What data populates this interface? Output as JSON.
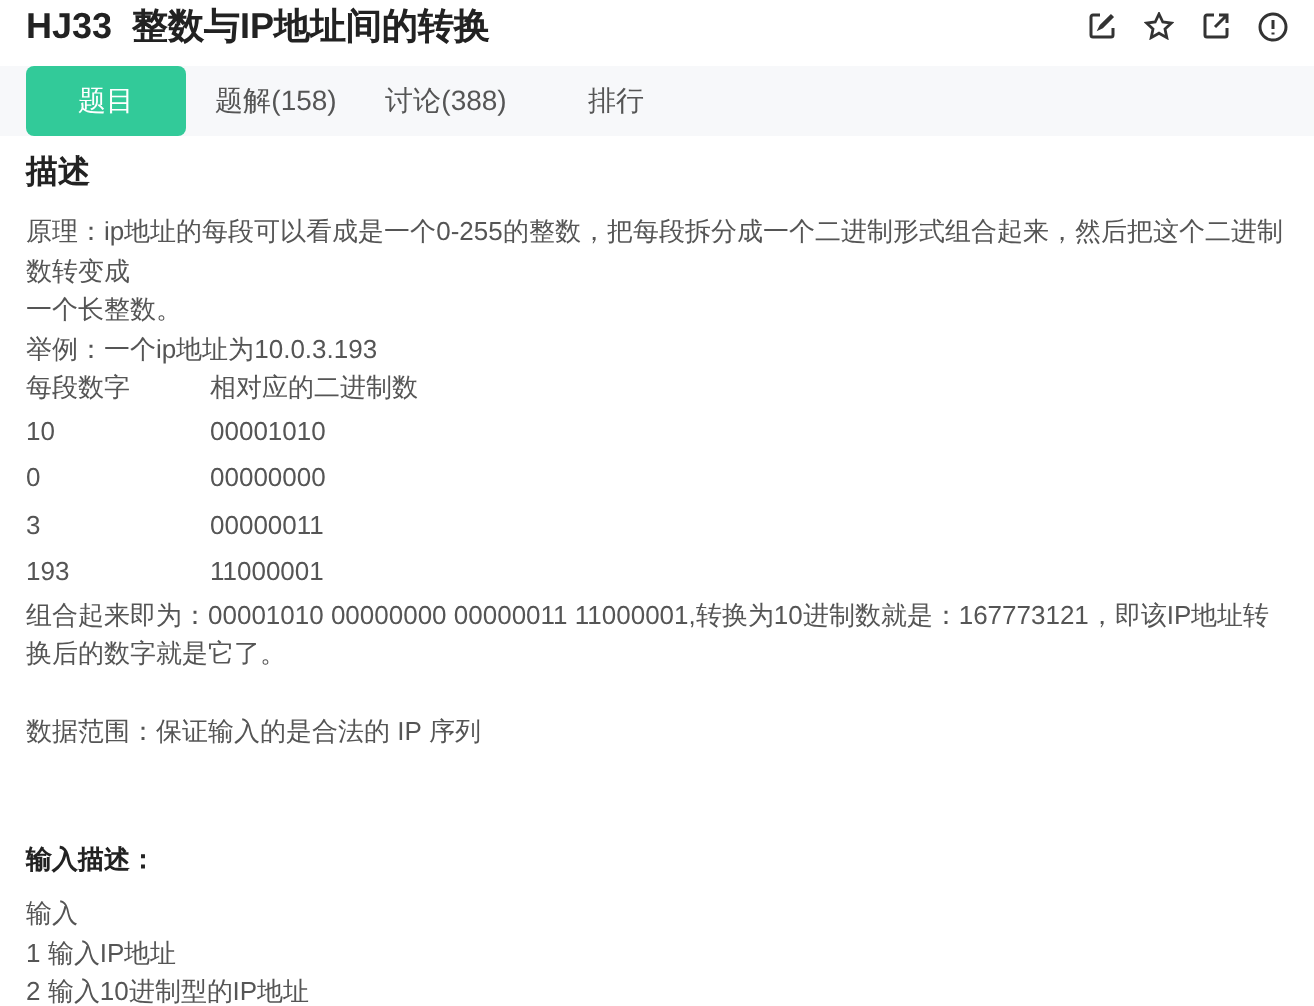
{
  "title": {
    "code": "HJ33",
    "name": "整数与IP地址间的转换"
  },
  "tabs": [
    {
      "label": "题目",
      "selected": true
    },
    {
      "label": "题解(158)",
      "selected": false
    },
    {
      "label": "讨论(388)",
      "selected": false
    },
    {
      "label": "排行",
      "selected": false
    }
  ],
  "description": {
    "heading": "描述",
    "lines": [
      "原理：ip地址的每段可以看成是一个0-255的整数，把每段拆分成一个二进制形式组合起来，然后把这个二进制数转变成",
      "一个长整数。",
      "举例：一个ip地址为10.0.3.193"
    ],
    "table": [
      [
        "每段数字",
        "相对应的二进制数"
      ],
      [
        "10",
        "00001010"
      ],
      [
        "0",
        "00000000"
      ],
      [
        "3",
        "00000011"
      ],
      [
        "193",
        "11000001"
      ]
    ],
    "summary": "组合起来即为：00001010 00000000 00000011 11000001,转换为10进制数就是：167773121，即该IP地址转换后的数字就是它了。",
    "range": "数据范围：保证输入的是合法的 IP 序列"
  },
  "input": {
    "heading": "输入描述：",
    "lines": [
      "输入",
      "1 输入IP地址",
      "2 输入10进制型的IP地址"
    ]
  }
}
